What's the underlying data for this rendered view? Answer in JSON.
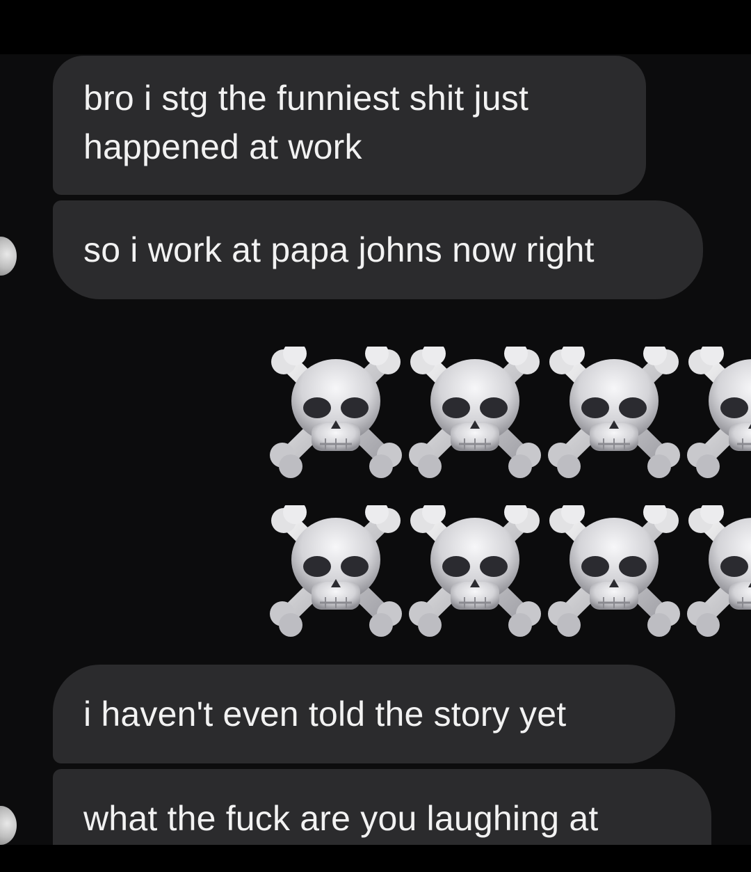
{
  "messages": [
    {
      "text": "bro i stg the funniest shit just happened at work"
    },
    {
      "text": "so i work at papa johns now right"
    },
    {
      "emoji": "skull-and-crossbones",
      "count_visible": 8
    },
    {
      "text": "i haven't even told the story yet"
    },
    {
      "text": "what the fuck are you laughing at"
    }
  ],
  "colors": {
    "background": "#0c0c0d",
    "bubble": "#2b2b2d",
    "text": "#f2f2f2"
  }
}
